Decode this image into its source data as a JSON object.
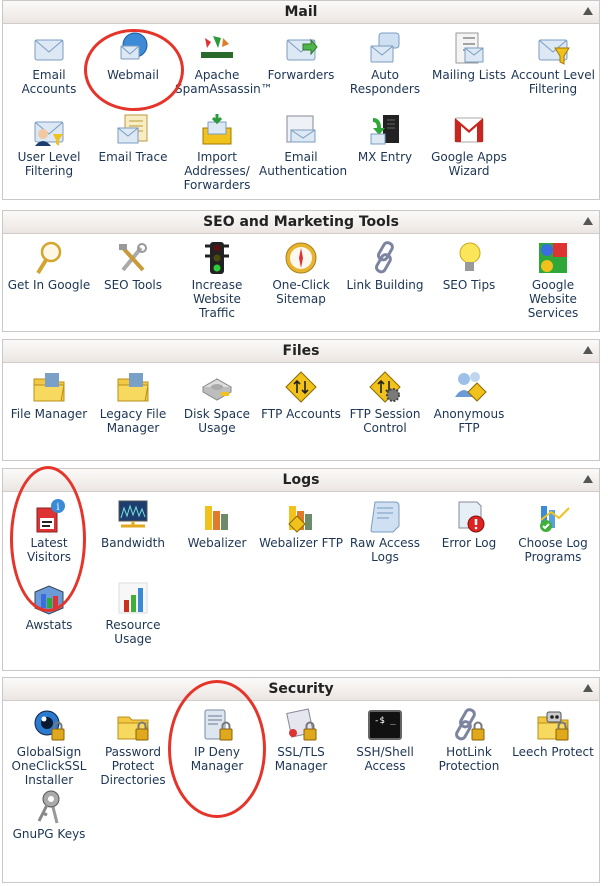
{
  "sections": [
    {
      "title": "Mail",
      "items": [
        {
          "label": "Email Accounts",
          "icon": "envelope-icon"
        },
        {
          "label": "Webmail",
          "icon": "webmail-globe-icon"
        },
        {
          "label": "Apache SpamAssassin™",
          "icon": "spamassassin-icon"
        },
        {
          "label": "Forwarders",
          "icon": "forward-envelope-icon"
        },
        {
          "label": "Auto Responders",
          "icon": "auto-responder-icon"
        },
        {
          "label": "Mailing Lists",
          "icon": "mailing-list-icon"
        },
        {
          "label": "Account Level Filtering",
          "icon": "filter-funnel-icon"
        },
        {
          "label": "User Level Filtering",
          "icon": "user-filter-icon"
        },
        {
          "label": "Email Trace",
          "icon": "email-trace-icon"
        },
        {
          "label": "Import Addresses/ Forwarders",
          "icon": "import-box-icon"
        },
        {
          "label": "Email Authentication",
          "icon": "email-auth-icon"
        },
        {
          "label": "MX Entry",
          "icon": "mx-server-icon"
        },
        {
          "label": "Google Apps Wizard",
          "icon": "gmail-icon"
        }
      ]
    },
    {
      "title": "SEO and Marketing Tools",
      "items": [
        {
          "label": "Get In Google",
          "icon": "magnifier-icon"
        },
        {
          "label": "SEO Tools",
          "icon": "tools-icon"
        },
        {
          "label": "Increase Website Traffic",
          "icon": "traffic-light-icon"
        },
        {
          "label": "One-Click Sitemap",
          "icon": "compass-icon"
        },
        {
          "label": "Link Building",
          "icon": "chain-link-icon"
        },
        {
          "label": "SEO Tips",
          "icon": "lightbulb-icon"
        },
        {
          "label": "Google Website Services",
          "icon": "google-services-icon"
        }
      ]
    },
    {
      "title": "Files",
      "items": [
        {
          "label": "File Manager",
          "icon": "folder-icon"
        },
        {
          "label": "Legacy File Manager",
          "icon": "folder-icon"
        },
        {
          "label": "Disk Space Usage",
          "icon": "disk-drive-icon"
        },
        {
          "label": "FTP Accounts",
          "icon": "ftp-icon"
        },
        {
          "label": "FTP Session Control",
          "icon": "ftp-gear-icon"
        },
        {
          "label": "Anonymous FTP",
          "icon": "anonymous-ftp-icon"
        }
      ]
    },
    {
      "title": "Logs",
      "items": [
        {
          "label": "Latest Visitors",
          "icon": "latest-visitors-icon"
        },
        {
          "label": "Bandwidth",
          "icon": "bandwidth-monitor-icon"
        },
        {
          "label": "Webalizer",
          "icon": "bar-chart-icon"
        },
        {
          "label": "Webalizer FTP",
          "icon": "bar-chart-ftp-icon"
        },
        {
          "label": "Raw Access Logs",
          "icon": "document-scroll-icon"
        },
        {
          "label": "Error Log",
          "icon": "error-log-icon"
        },
        {
          "label": "Choose Log Programs",
          "icon": "log-programs-icon"
        },
        {
          "label": "Awstats",
          "icon": "awstats-icon"
        },
        {
          "label": "Resource Usage",
          "icon": "resource-chart-icon"
        }
      ]
    },
    {
      "title": "Security",
      "items": [
        {
          "label": "GlobalSign OneClickSSL Installer",
          "icon": "eye-lock-icon"
        },
        {
          "label": "Password Protect Directories",
          "icon": "folder-lock-icon"
        },
        {
          "label": "IP Deny Manager",
          "icon": "server-lock-icon"
        },
        {
          "label": "SSL/TLS Manager",
          "icon": "certificate-lock-icon"
        },
        {
          "label": "SSH/Shell Access",
          "icon": "terminal-icon"
        },
        {
          "label": "HotLink Protection",
          "icon": "chain-lock-icon"
        },
        {
          "label": "Leech Protect",
          "icon": "leech-folder-icon"
        },
        {
          "label": "GnuPG Keys",
          "icon": "keys-icon"
        }
      ]
    }
  ],
  "highlights": [
    "Webmail",
    "Latest Visitors",
    "IP Deny Manager"
  ]
}
